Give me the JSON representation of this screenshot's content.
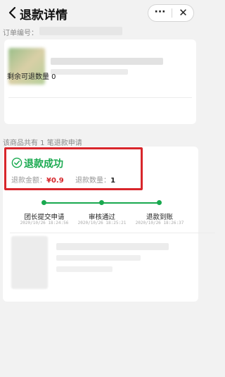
{
  "navbar": {
    "title": "退款详情",
    "back_icon": "chevron-left-icon",
    "more_label": "···",
    "close_label": "✕"
  },
  "order": {
    "label": "订单编号："
  },
  "product": {
    "remaining_refund_label": "剩余可退数量 0"
  },
  "refund_summary": {
    "count_text": "该商品共有 1 笔退款申请"
  },
  "refund": {
    "status": "退款成功",
    "amount_label": "退款金额：",
    "amount_value": "¥0.9",
    "quantity_label": "退款数量：",
    "quantity_value": "1",
    "status_color": "#19a94f",
    "amount_color": "#d6262b"
  },
  "progress": {
    "steps": [
      {
        "label": "团长提交申请",
        "time": "2020/10/26 18:24:56"
      },
      {
        "label": "审核通过",
        "time": "2020/10/26 18:25:21"
      },
      {
        "label": "退款到账",
        "time": "2020/10/26 18:26:37"
      }
    ]
  }
}
